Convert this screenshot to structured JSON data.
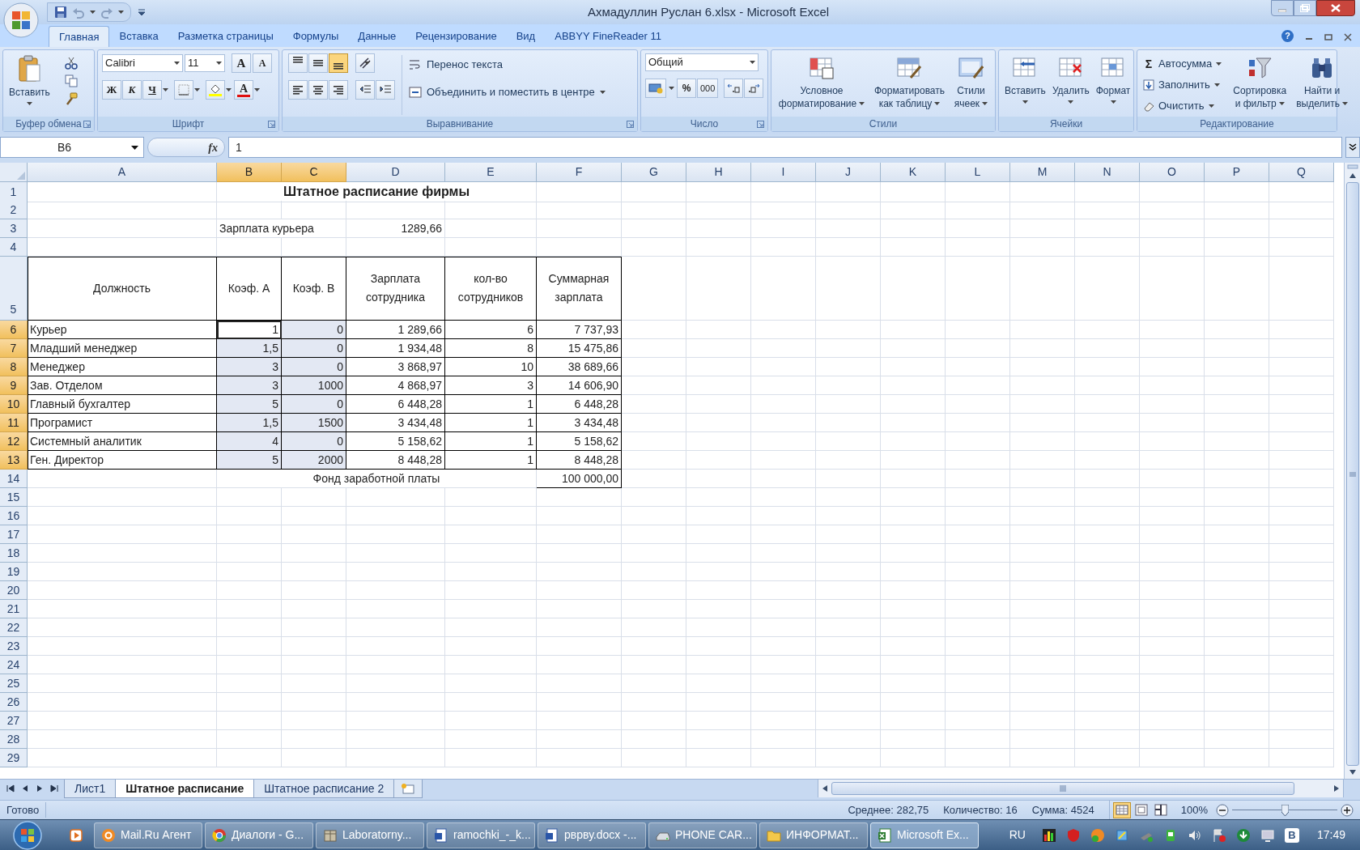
{
  "window": {
    "title": "Ахмадуллин Руслан 6.xlsx - Microsoft Excel",
    "help": "?"
  },
  "ribbon": {
    "tabs": [
      {
        "label": "Главная",
        "selected": true
      },
      {
        "label": "Вставка",
        "selected": false
      },
      {
        "label": "Разметка страницы",
        "selected": false
      },
      {
        "label": "Формулы",
        "selected": false
      },
      {
        "label": "Данные",
        "selected": false
      },
      {
        "label": "Рецензирование",
        "selected": false
      },
      {
        "label": "Вид",
        "selected": false
      },
      {
        "label": "ABBYY FineReader 11",
        "selected": false
      }
    ],
    "groups": [
      {
        "kind": "clipboard",
        "label": "Буфер обмена",
        "paste": "Вставить"
      },
      {
        "kind": "font",
        "label": "Шрифт",
        "font_name": "Calibri",
        "font_size": "11",
        "grow": "A",
        "shrink": "A",
        "styles": [
          "Ж",
          "К",
          "Ч"
        ],
        "font_color": "A"
      },
      {
        "kind": "alignment",
        "label": "Выравнивание",
        "vertical": [
          {
            "selected": false
          },
          {
            "selected": false
          },
          {
            "selected": true
          }
        ],
        "wrap": "Перенос текста",
        "merge": "Объединить и поместить в центре"
      },
      {
        "kind": "number",
        "label": "Число",
        "format": "Общий",
        "percent": "%",
        "thousands": "000"
      },
      {
        "kind": "styles",
        "label": "Стили",
        "buttons": [
          {
            "lines": [
              "Условное",
              "форматирование"
            ]
          },
          {
            "lines": [
              "Форматировать",
              "как таблицу"
            ]
          },
          {
            "lines": [
              "Стили",
              "ячеек"
            ]
          }
        ]
      },
      {
        "kind": "cells",
        "label": "Ячейки",
        "buttons": [
          "Вставить",
          "Удалить",
          "Формат"
        ]
      },
      {
        "kind": "editing",
        "label": "Редактирование",
        "sigma": "Σ",
        "commands": [
          "Автосумма",
          "Заполнить",
          "Очистить"
        ],
        "buttons": [
          {
            "lines": [
              "Сортировка",
              "и фильтр"
            ]
          },
          {
            "lines": [
              "Найти и",
              "выделить"
            ]
          }
        ]
      }
    ]
  },
  "formula_bar": {
    "name_box": "B6",
    "fx": "fx",
    "value": "1"
  },
  "sheet": {
    "columns": [
      {
        "label": "A",
        "selected": false
      },
      {
        "label": "B",
        "selected": true
      },
      {
        "label": "C",
        "selected": true
      },
      {
        "label": "D",
        "selected": false
      },
      {
        "label": "E",
        "selected": false
      },
      {
        "label": "F",
        "selected": false
      },
      {
        "label": "G",
        "selected": false
      },
      {
        "label": "H",
        "selected": false
      },
      {
        "label": "I",
        "selected": false
      },
      {
        "label": "J",
        "selected": false
      },
      {
        "label": "K",
        "selected": false
      },
      {
        "label": "L",
        "selected": false
      },
      {
        "label": "M",
        "selected": false
      },
      {
        "label": "N",
        "selected": false
      },
      {
        "label": "O",
        "selected": false
      },
      {
        "label": "P",
        "selected": false
      },
      {
        "label": "Q",
        "selected": false
      }
    ],
    "rows": [
      {
        "label": "1",
        "selected": false,
        "cells": {
          "B": {
            "text": "Штатное расписание фирмы",
            "kind": "title"
          }
        }
      },
      {
        "label": "2",
        "selected": false
      },
      {
        "label": "3",
        "selected": false,
        "cells": {
          "B": {
            "text": "Зарплата курьера",
            "kind": "text"
          },
          "D": {
            "text": "1289,66",
            "kind": "number"
          }
        }
      },
      {
        "label": "4",
        "selected": false
      },
      {
        "label": "5",
        "selected": false,
        "cells": {
          "A": {
            "text": "Должность",
            "kind": "heading",
            "boxed": true
          },
          "B": {
            "text": "Коэф. A",
            "kind": "heading",
            "boxed": true
          },
          "C": {
            "text": "Коэф. B",
            "kind": "heading",
            "boxed": true
          },
          "D": {
            "text": "Зарплата сотрудника",
            "kind": "heading",
            "boxed": true
          },
          "E": {
            "text": "кол-во сотрудников",
            "kind": "heading",
            "boxed": true
          },
          "F": {
            "text": "Суммарная зарплата",
            "kind": "heading",
            "boxed": true
          }
        }
      },
      {
        "label": "6",
        "selected": true,
        "cells": {
          "A": {
            "text": "Курьер",
            "kind": "text",
            "boxed": true
          },
          "B": {
            "text": "1",
            "kind": "number",
            "boxed": true,
            "active": true
          },
          "C": {
            "text": "0",
            "kind": "number",
            "boxed": true
          },
          "D": {
            "text": "1 289,66",
            "kind": "number",
            "boxed": true
          },
          "E": {
            "text": "6",
            "kind": "number",
            "boxed": true
          },
          "F": {
            "text": "7 737,93",
            "kind": "number",
            "boxed": true
          }
        }
      },
      {
        "label": "7",
        "selected": true,
        "cells": {
          "A": {
            "text": "Младший менеджер",
            "kind": "text",
            "boxed": true
          },
          "B": {
            "text": "1,5",
            "kind": "number",
            "boxed": true
          },
          "C": {
            "text": "0",
            "kind": "number",
            "boxed": true
          },
          "D": {
            "text": "1 934,48",
            "kind": "number",
            "boxed": true
          },
          "E": {
            "text": "8",
            "kind": "number",
            "boxed": true
          },
          "F": {
            "text": "15 475,86",
            "kind": "number",
            "boxed": true
          }
        }
      },
      {
        "label": "8",
        "selected": true,
        "cells": {
          "A": {
            "text": "Менеджер",
            "kind": "text",
            "boxed": true
          },
          "B": {
            "text": "3",
            "kind": "number",
            "boxed": true
          },
          "C": {
            "text": "0",
            "kind": "number",
            "boxed": true
          },
          "D": {
            "text": "3 868,97",
            "kind": "number",
            "boxed": true
          },
          "E": {
            "text": "10",
            "kind": "number",
            "boxed": true
          },
          "F": {
            "text": "38 689,66",
            "kind": "number",
            "boxed": true
          }
        }
      },
      {
        "label": "9",
        "selected": true,
        "cells": {
          "A": {
            "text": "Зав. Отделом",
            "kind": "text",
            "boxed": true
          },
          "B": {
            "text": "3",
            "kind": "number",
            "boxed": true
          },
          "C": {
            "text": "1000",
            "kind": "number",
            "boxed": true
          },
          "D": {
            "text": "4 868,97",
            "kind": "number",
            "boxed": true
          },
          "E": {
            "text": "3",
            "kind": "number",
            "boxed": true
          },
          "F": {
            "text": "14 606,90",
            "kind": "number",
            "boxed": true
          }
        }
      },
      {
        "label": "10",
        "selected": true,
        "cells": {
          "A": {
            "text": "Главный бухгалтер",
            "kind": "text",
            "boxed": true
          },
          "B": {
            "text": "5",
            "kind": "number",
            "boxed": true
          },
          "C": {
            "text": "0",
            "kind": "number",
            "boxed": true
          },
          "D": {
            "text": "6 448,28",
            "kind": "number",
            "boxed": true
          },
          "E": {
            "text": "1",
            "kind": "number",
            "boxed": true
          },
          "F": {
            "text": "6 448,28",
            "kind": "number",
            "boxed": true
          }
        }
      },
      {
        "label": "11",
        "selected": true,
        "cells": {
          "A": {
            "text": "Програмист",
            "kind": "text",
            "boxed": true
          },
          "B": {
            "text": "1,5",
            "kind": "number",
            "boxed": true
          },
          "C": {
            "text": "1500",
            "kind": "number",
            "boxed": true
          },
          "D": {
            "text": "3 434,48",
            "kind": "number",
            "boxed": true
          },
          "E": {
            "text": "1",
            "kind": "number",
            "boxed": true
          },
          "F": {
            "text": "3 434,48",
            "kind": "number",
            "boxed": true
          }
        }
      },
      {
        "label": "12",
        "selected": true,
        "cells": {
          "A": {
            "text": "Системный аналитик",
            "kind": "text",
            "boxed": true
          },
          "B": {
            "text": "4",
            "kind": "number",
            "boxed": true
          },
          "C": {
            "text": "0",
            "kind": "number",
            "boxed": true
          },
          "D": {
            "text": "5 158,62",
            "kind": "number",
            "boxed": true
          },
          "E": {
            "text": "1",
            "kind": "number",
            "boxed": true
          },
          "F": {
            "text": "5 158,62",
            "kind": "number",
            "boxed": true
          }
        }
      },
      {
        "label": "13",
        "selected": true,
        "cells": {
          "A": {
            "text": "Ген. Директор",
            "kind": "text",
            "boxed": true
          },
          "B": {
            "text": "5",
            "kind": "number",
            "boxed": true
          },
          "C": {
            "text": "2000",
            "kind": "number",
            "boxed": true
          },
          "D": {
            "text": "8 448,28",
            "kind": "number",
            "boxed": true
          },
          "E": {
            "text": "1",
            "kind": "number",
            "boxed": true
          },
          "F": {
            "text": "8 448,28",
            "kind": "number",
            "boxed": true
          }
        }
      },
      {
        "label": "14",
        "selected": false,
        "cells": {
          "B": {
            "text": "Фонд заработной платы",
            "kind": "caption"
          },
          "F": {
            "text": "100 000,00",
            "kind": "number",
            "boxed": true
          }
        }
      },
      {
        "label": "15",
        "selected": false
      },
      {
        "label": "16",
        "selected": false
      },
      {
        "label": "17",
        "selected": false
      },
      {
        "label": "18",
        "selected": false
      },
      {
        "label": "19",
        "selected": false
      },
      {
        "label": "20",
        "selected": false
      },
      {
        "label": "21",
        "selected": false
      },
      {
        "label": "22",
        "selected": false
      },
      {
        "label": "23",
        "selected": false
      },
      {
        "label": "24",
        "selected": false
      },
      {
        "label": "25",
        "selected": false
      },
      {
        "label": "26",
        "selected": false
      },
      {
        "label": "27",
        "selected": false
      },
      {
        "label": "28",
        "selected": false
      },
      {
        "label": "29",
        "selected": false
      }
    ]
  },
  "sheet_tabs": [
    {
      "label": "Лист1",
      "selected": false
    },
    {
      "label": "Штатное расписание",
      "selected": true
    },
    {
      "label": "Штатное расписание 2",
      "selected": false
    }
  ],
  "status_bar": {
    "status": "Готово",
    "stats": [
      "Среднее: 282,75",
      "Количество: 16",
      "Сумма: 4524"
    ],
    "views": [
      {
        "selected": true
      },
      {
        "selected": false
      },
      {
        "selected": false
      }
    ],
    "zoom": "100%",
    "zoom_slider": {
      "level": 0.5
    }
  },
  "taskbar": {
    "items": [
      {
        "label": "Mail.Ru Агент",
        "kind": "mail",
        "selected": false
      },
      {
        "label": "Диалоги - G...",
        "kind": "browser",
        "selected": false
      },
      {
        "label": "Laboratorny...",
        "kind": "archive",
        "selected": false
      },
      {
        "label": "ramochki_-_k...",
        "kind": "document",
        "selected": false
      },
      {
        "label": "рврву.docx -...",
        "kind": "document",
        "selected": false
      },
      {
        "label": "PHONE CAR...",
        "kind": "drive",
        "selected": false
      },
      {
        "label": "ИНФОРМАТ...",
        "kind": "folder",
        "selected": false
      },
      {
        "label": "Microsoft Ex...",
        "kind": "spreadsheet",
        "selected": true
      }
    ],
    "language": "RU",
    "tray_badge": "В",
    "clock": "17:49"
  }
}
